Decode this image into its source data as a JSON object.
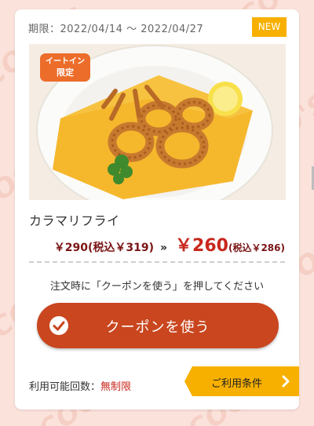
{
  "coupon": {
    "period_label": "期限：",
    "period_start": "2022/04/14",
    "period_sep": "〜",
    "period_end": "2022/04/27",
    "new_badge": "NEW",
    "eatin_line1": "イートイン",
    "eatin_line2": "限定",
    "product_name": "カラマリフライ",
    "old_price": "￥290(税込￥319)",
    "arrows": "»",
    "new_price": "￥260",
    "new_price_tax": "(税込￥286)",
    "instruction": "注文時に「クーポンを使う」を押してください",
    "use_button_label": "クーポンを使う",
    "usage_label": "利用可能回数：",
    "usage_value": "無制限",
    "conditions_label": "ご利用条件"
  },
  "background": {
    "watermark_text": "COCO'S"
  },
  "colors": {
    "background": "#fbe3dc",
    "badge_yellow": "#f7b000",
    "button_red": "#c9461f",
    "price_red": "#c8271d",
    "eatin_orange": "#ec6d2a"
  },
  "icons": {
    "eatin_badge_icon": "fork-knife-icon",
    "use_button_icon": "check-circle-icon",
    "conditions_icon": "chevron-right-icon"
  }
}
